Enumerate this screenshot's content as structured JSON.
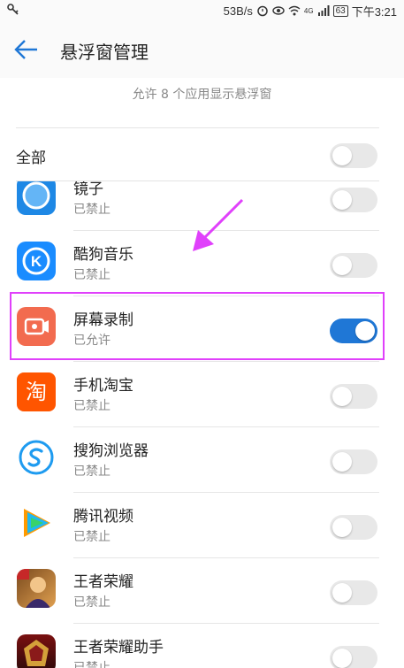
{
  "status_bar": {
    "speed": "53B/s",
    "network": "4G",
    "battery": "63",
    "time": "下午3:21"
  },
  "header": {
    "title": "悬浮窗管理"
  },
  "summary": "允许 8 个应用显示悬浮窗",
  "all_toggle": {
    "label": "全部",
    "on": false
  },
  "apps": [
    {
      "name": "镜子",
      "status": "已禁止",
      "on": false,
      "icon": "mirror-app-icon"
    },
    {
      "name": "酷狗音乐",
      "status": "已禁止",
      "on": false,
      "icon": "kugou-music-icon"
    },
    {
      "name": "屏幕录制",
      "status": "已允许",
      "on": true,
      "icon": "screen-record-icon"
    },
    {
      "name": "手机淘宝",
      "status": "已禁止",
      "on": false,
      "icon": "taobao-icon"
    },
    {
      "name": "搜狗浏览器",
      "status": "已禁止",
      "on": false,
      "icon": "sogou-browser-icon"
    },
    {
      "name": "腾讯视频",
      "status": "已禁止",
      "on": false,
      "icon": "tencent-video-icon"
    },
    {
      "name": "王者荣耀",
      "status": "已禁止",
      "on": false,
      "icon": "honor-of-kings-icon"
    },
    {
      "name": "王者荣耀助手",
      "status": "已禁止",
      "on": false,
      "icon": "honor-of-kings-assistant-icon"
    }
  ],
  "icon_glyphs": {
    "taobao": "淘"
  },
  "colors": {
    "accent": "#1f77d6",
    "annotation": "#e040fb",
    "kugou": "#1a8cff",
    "record": "#f26b4f",
    "taobao": "#ff5500"
  }
}
